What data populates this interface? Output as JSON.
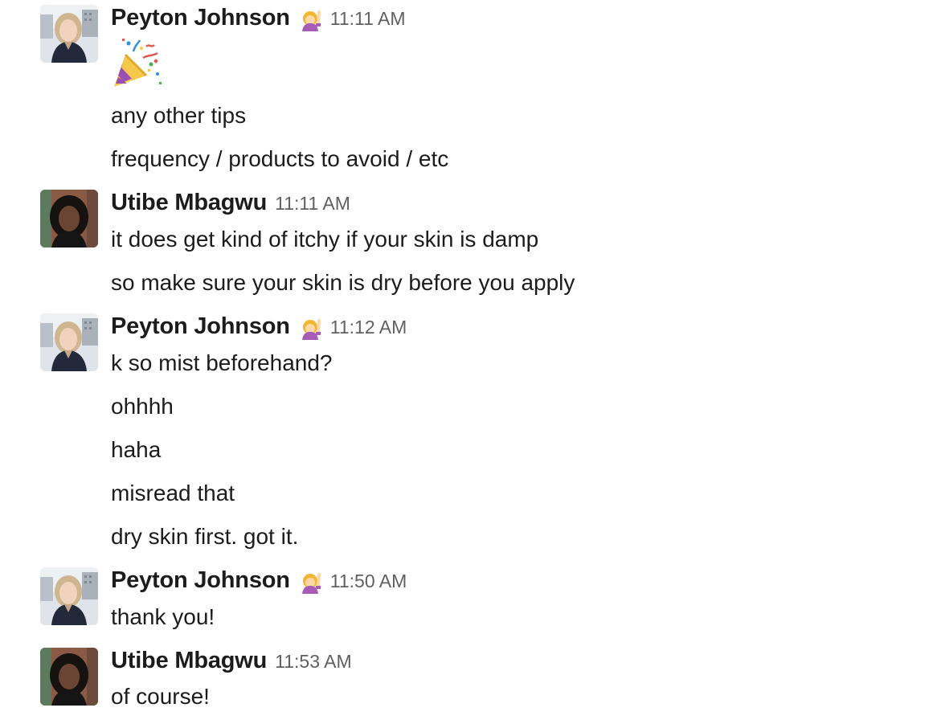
{
  "messages": [
    {
      "author": "Peyton Johnson",
      "status_icon": "raising-hand-icon",
      "time": "11:11 AM",
      "lines": [
        "any other tips",
        "frequency / products to avoid / etc"
      ],
      "emoji_message": "party-popper-icon"
    },
    {
      "author": "Utibe Mbagwu",
      "time": "11:11 AM",
      "lines": [
        "it does get kind of itchy if your skin is damp",
        "so make sure your skin is dry before you apply"
      ]
    },
    {
      "author": "Peyton Johnson",
      "status_icon": "raising-hand-icon",
      "time": "11:12 AM",
      "lines": [
        "k so mist beforehand?",
        "ohhhh",
        "haha",
        "misread that",
        "dry skin first. got it."
      ]
    },
    {
      "author": "Peyton Johnson",
      "status_icon": "raising-hand-icon",
      "time": "11:50 AM",
      "lines": [
        "thank you!"
      ]
    },
    {
      "author": "Utibe Mbagwu",
      "time": "11:53 AM",
      "lines": [
        "of course!"
      ]
    }
  ]
}
